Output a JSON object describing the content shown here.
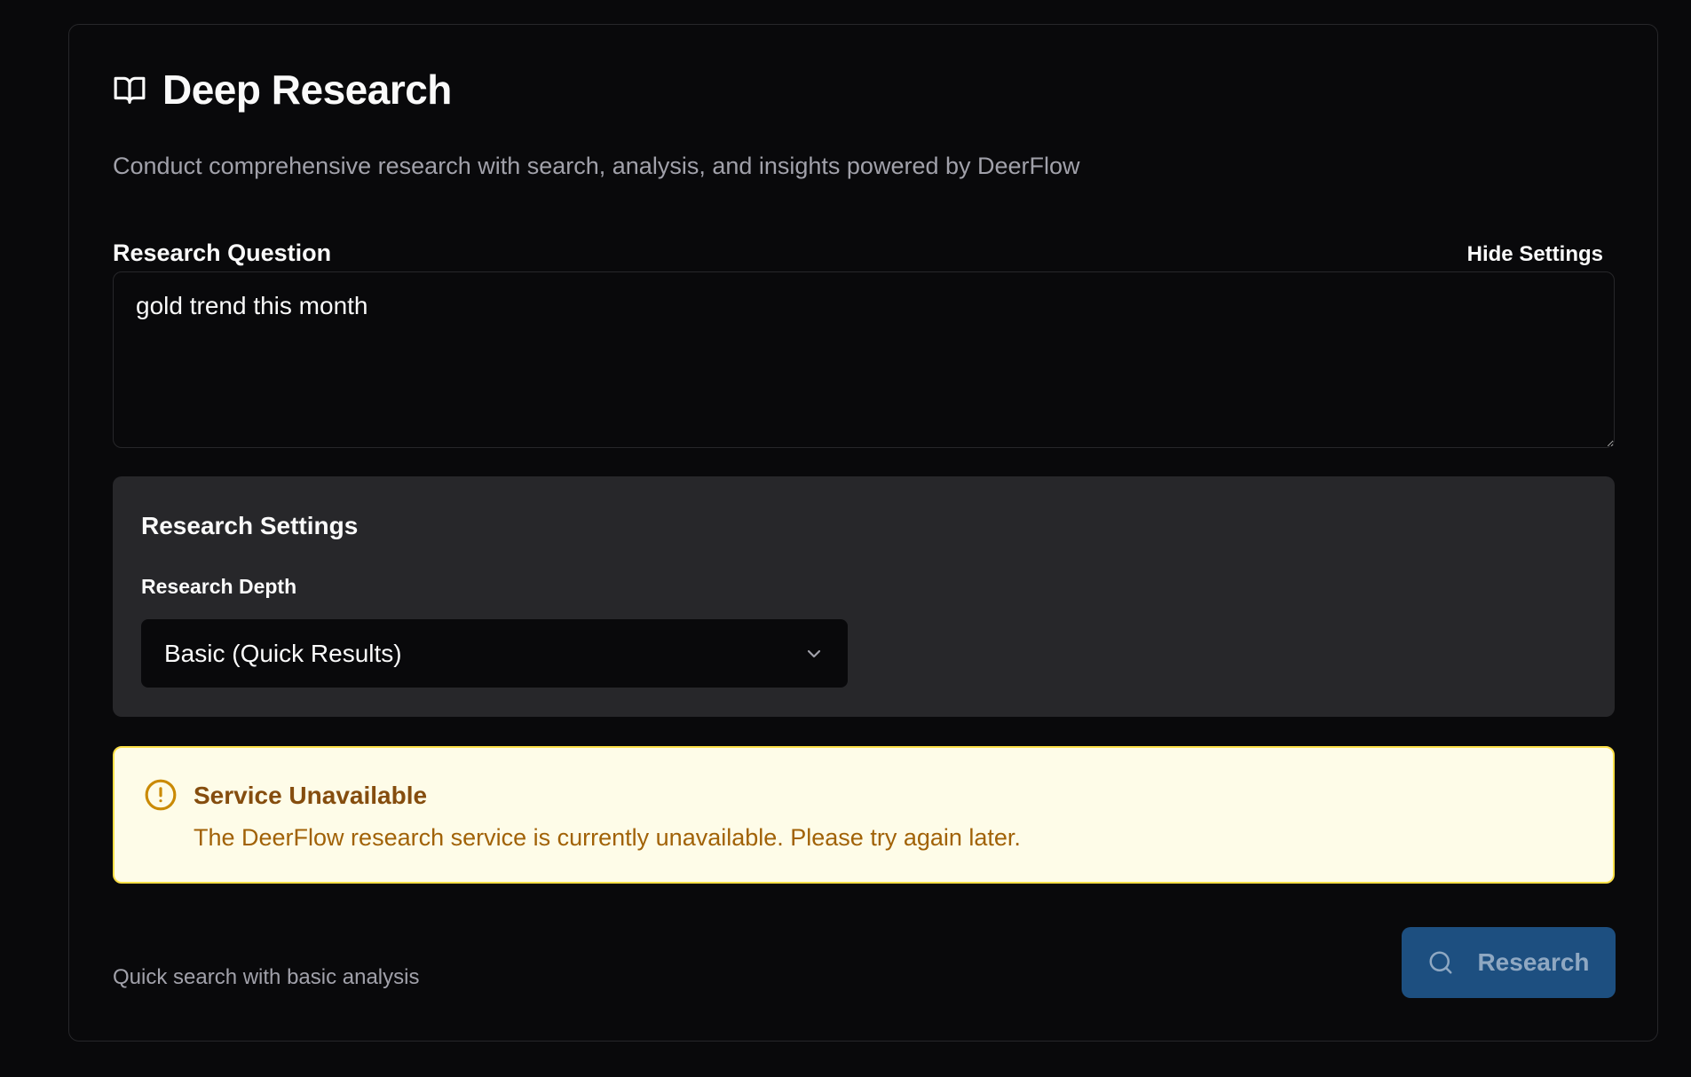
{
  "header": {
    "title": "Deep Research",
    "subtitle": "Conduct comprehensive research with search, analysis, and insights powered by DeerFlow",
    "icon": "book-open-icon"
  },
  "question": {
    "label": "Research Question",
    "value": "gold trend this month",
    "toggle_settings_label": "Hide Settings"
  },
  "settings": {
    "title": "Research Settings",
    "depth_label": "Research Depth",
    "depth_selected": "Basic (Quick Results)"
  },
  "alert": {
    "title": "Service Unavailable",
    "message": "The DeerFlow research service is currently unavailable. Please try again later.",
    "icon": "alert-circle-icon",
    "color": "#ca8a04"
  },
  "footer": {
    "hint": "Quick search with basic analysis",
    "button_label": "Research",
    "button_icon": "search-icon"
  },
  "colors": {
    "background": "#09090b",
    "panel": "#27272a",
    "accent": "#1d4f80",
    "alert_bg": "#fefce8",
    "alert_border": "#fde047"
  }
}
